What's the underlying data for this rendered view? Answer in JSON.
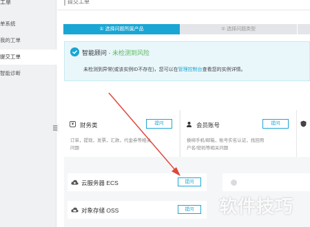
{
  "sidebar": {
    "header": "工单",
    "items": [
      {
        "label": "单系统",
        "active": false
      },
      {
        "label": "我的工单",
        "active": false
      },
      {
        "label": "提交工单",
        "active": true
      },
      {
        "label": "智能诊断",
        "active": false
      }
    ]
  },
  "main": {
    "title": "提交工单",
    "steps": [
      {
        "label": "① 选择问题所属产品",
        "active": true
      },
      {
        "label": "② 选择问题类型",
        "active": false
      }
    ],
    "alert": {
      "icon": "smart-advisor-icon",
      "title": "智能顾问 · ",
      "status": "未检测到风险",
      "text_before": "未检测到异常(或该实例ID不存在)，您可以在",
      "link": "管理控制台",
      "text_after": "查看您的实例详情。"
    },
    "categories": [
      {
        "icon": "yen-icon",
        "title": "财务类",
        "button": "提问",
        "desc_line1": "订单，提现，发票，汇款，代金券等相关",
        "desc_line2": "问题"
      },
      {
        "icon": "user-icon",
        "title": "会员账号",
        "button": "提问",
        "desc_line1": "换绑手机/邮箱，账号实名认证，找回用",
        "desc_line2": "户名/密码等相关问题"
      }
    ],
    "products": [
      {
        "icon": "cloud-icon",
        "title": "云服务器 ECS",
        "button": "提问"
      },
      {
        "icon": "storage-icon",
        "title": "对象存储 OSS",
        "button": "提问"
      }
    ],
    "watermark": "软件技巧"
  },
  "colors": {
    "accent": "#19a6d4",
    "arrow": "#e0463a",
    "success": "#5cb85c"
  }
}
